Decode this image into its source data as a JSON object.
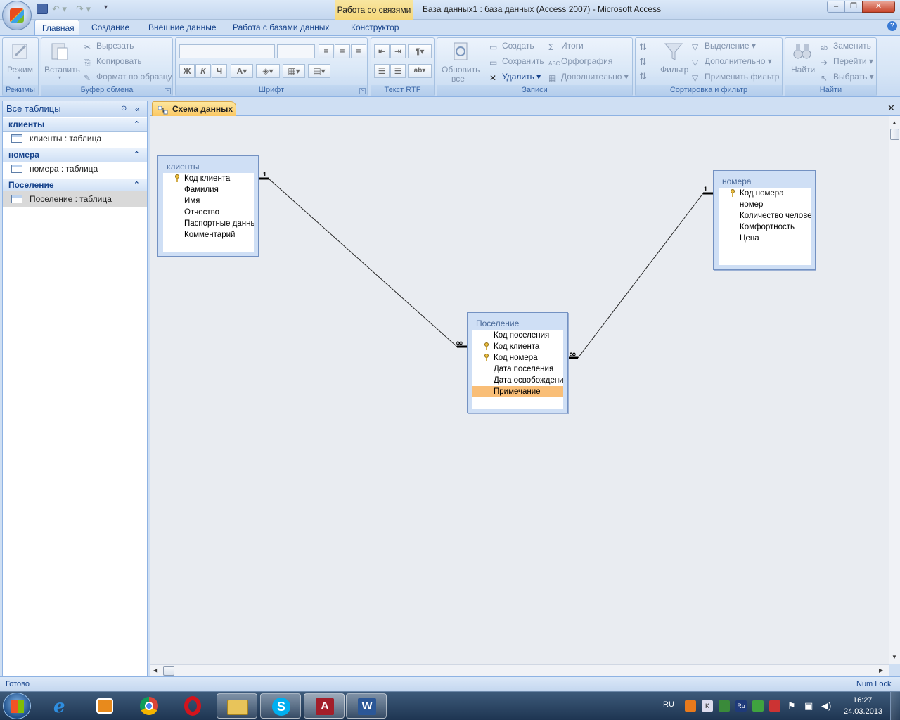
{
  "window": {
    "contextual_tab": "Работа со связями",
    "title": "База данных1 : база данных (Access 2007)  -  Microsoft Access"
  },
  "ribbon": {
    "tabs": [
      "Главная",
      "Создание",
      "Внешние данные",
      "Работа с базами данных",
      "Конструктор"
    ],
    "groups": {
      "modes": {
        "label": "Режимы",
        "view_button": "Режим"
      },
      "clipboard": {
        "label": "Буфер обмена",
        "paste": "Вставить",
        "cut": "Вырезать",
        "copy": "Копировать",
        "format_painter": "Формат по образцу"
      },
      "font": {
        "label": "Шрифт",
        "bold": "Ж",
        "italic": "К",
        "underline": "Ч"
      },
      "rtf": {
        "label": "Текст RTF"
      },
      "records": {
        "label": "Записи",
        "refresh": "Обновить",
        "refresh2": "все",
        "new": "Создать",
        "save": "Сохранить",
        "delete": "Удалить",
        "totals": "Итоги",
        "spelling": "Орфография",
        "more": "Дополнительно"
      },
      "sort_filter": {
        "label": "Сортировка и фильтр",
        "filter": "Фильтр",
        "selection": "Выделение",
        "advanced": "Дополнительно",
        "apply_filter": "Применить фильтр"
      },
      "find": {
        "label": "Найти",
        "find_button": "Найти",
        "replace": "Заменить",
        "goto": "Перейти",
        "select": "Выбрать"
      }
    }
  },
  "nav_pane": {
    "header": "Все таблицы",
    "groups": [
      {
        "name": "клиенты",
        "item": "клиенты : таблица"
      },
      {
        "name": "номера",
        "item": "номера : таблица"
      },
      {
        "name": "Поселение",
        "item": "Поселение : таблица"
      }
    ]
  },
  "document": {
    "tab": "Схема данных",
    "tables": {
      "klienty": {
        "title": "клиенты",
        "fields": [
          "Код клиента",
          "Фамилия",
          "Имя",
          "Отчество",
          "Паспортные данные",
          "Комментарий"
        ]
      },
      "nomera": {
        "title": "номера",
        "fields": [
          "Код номера",
          "номер",
          "Количество человек",
          "Комфортность",
          "Цена"
        ]
      },
      "poselenie": {
        "title": "Поселение",
        "fields": [
          "Код поселения",
          "Код клиента",
          "Код номера",
          "Дата поселения",
          "Дата освобождения",
          "Примечание"
        ]
      }
    },
    "relationships": [
      {
        "from": "клиенты",
        "to": "Поселение",
        "one_label": "1",
        "many_label": "∞"
      },
      {
        "from": "номера",
        "to": "Поселение",
        "one_label": "1",
        "many_label": "∞"
      }
    ]
  },
  "status": {
    "left": "Готово",
    "right": "Num Lock"
  },
  "taskbar": {
    "lang": "RU",
    "time": "16:27",
    "date": "24.03.2013"
  }
}
